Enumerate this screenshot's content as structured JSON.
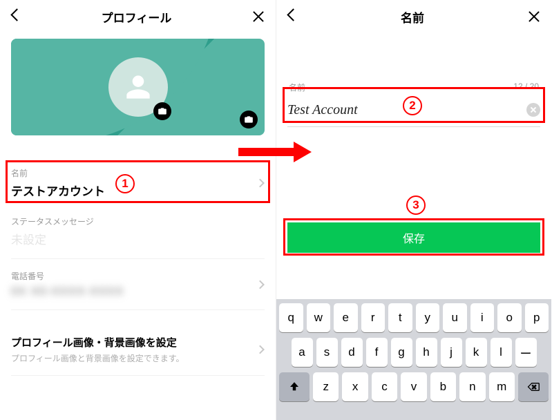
{
  "left": {
    "header_title": "プロフィール",
    "name_label": "名前",
    "name_value": "テストアカウント",
    "status_label": "ステータスメッセージ",
    "status_value": "未設定",
    "phone_label": "電話番号",
    "phone_value": "0X X0-XXXX-XXXX",
    "imgset_title": "プロフィール画像・背景画像を設定",
    "imgset_sub": "プロフィール画像と背景画像を設定できます。"
  },
  "right": {
    "header_title": "名前",
    "field_label": "名前",
    "counter": "12 / 20",
    "field_value": "Test Account",
    "save_label": "保存"
  },
  "annotations": {
    "step1": "1",
    "step2": "2",
    "step3": "3"
  },
  "keyboard": {
    "row1": [
      "q",
      "w",
      "e",
      "r",
      "t",
      "y",
      "u",
      "i",
      "o",
      "p"
    ],
    "row2": [
      "a",
      "s",
      "d",
      "f",
      "g",
      "h",
      "j",
      "k",
      "l",
      "ー"
    ],
    "row3": [
      "z",
      "x",
      "c",
      "v",
      "b",
      "n",
      "m"
    ]
  }
}
